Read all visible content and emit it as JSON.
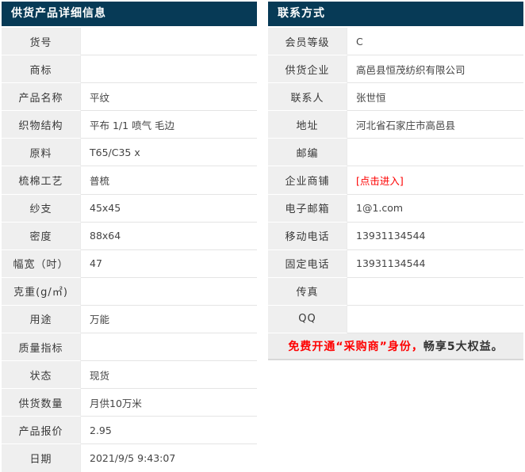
{
  "colors": {
    "header_bg": "#073a56",
    "label_bg": "#efefef",
    "promo_bg": "#ededed",
    "border": "#e4e4e4",
    "red": "#fe0000",
    "text": "#333333"
  },
  "product_panel": {
    "title": "供货产品详细信息",
    "rows": [
      {
        "label": "货号",
        "value": ""
      },
      {
        "label": "商标",
        "value": ""
      },
      {
        "label": "产品名称",
        "value": "平纹"
      },
      {
        "label": "织物结构",
        "value": "平布 1/1 喷气 毛边"
      },
      {
        "label": "原料",
        "value": "T65/C35 x"
      },
      {
        "label": "梳棉工艺",
        "value": "普梳"
      },
      {
        "label": "纱支",
        "value": "45x45"
      },
      {
        "label": "密度",
        "value": "88x64"
      },
      {
        "label": "幅宽（吋）",
        "value": "47"
      },
      {
        "label": "克重(g/㎡)",
        "value": ""
      },
      {
        "label": "用途",
        "value": "万能"
      },
      {
        "label": "质量指标",
        "value": ""
      },
      {
        "label": "状态",
        "value": "现货"
      },
      {
        "label": "供货数量",
        "value": "月供10万米"
      },
      {
        "label": "产品报价",
        "value": "2.95"
      },
      {
        "label": "日期",
        "value": "2021/9/5 9:43:07"
      }
    ]
  },
  "contact_panel": {
    "title": "联系方式",
    "rows": [
      {
        "label": "会员等级",
        "value": "C"
      },
      {
        "label": "供货企业",
        "value": "高邑县恒茂纺织有限公司"
      },
      {
        "label": "联系人",
        "value": "张世恒"
      },
      {
        "label": "地址",
        "value": "河北省石家庄市高邑县"
      },
      {
        "label": "邮编",
        "value": ""
      },
      {
        "label": "企业商铺",
        "value": "[点击进入]",
        "link": true
      },
      {
        "label": "电子邮箱",
        "value": "1@1.com"
      },
      {
        "label": "移动电话",
        "value": "13931134544"
      },
      {
        "label": "固定电话",
        "value": "13931134544"
      },
      {
        "label": "传真",
        "value": ""
      },
      {
        "label": "QQ",
        "value": ""
      }
    ],
    "promo": {
      "highlight": "免费开通“采购商”身份，",
      "rest": "畅享5大权益。"
    }
  }
}
